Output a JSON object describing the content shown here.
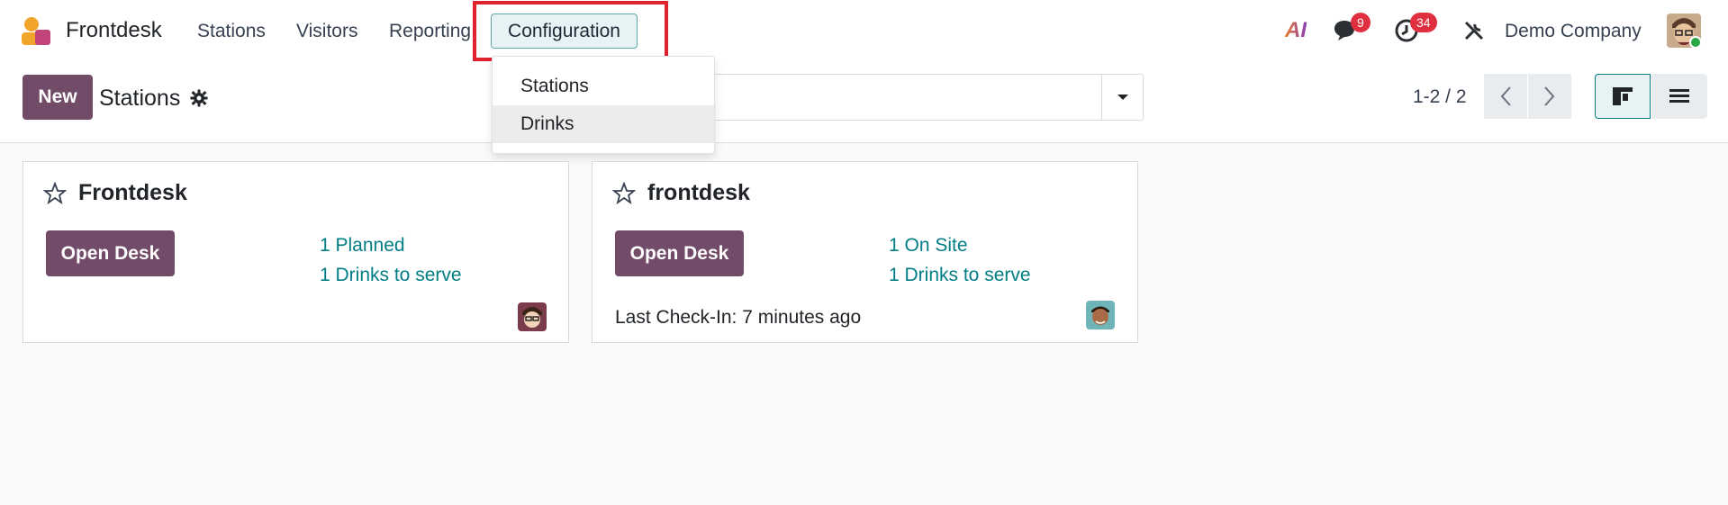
{
  "navbar": {
    "app_name": "Frontdesk",
    "menu": {
      "stations": "Stations",
      "visitors": "Visitors",
      "reporting": "Reporting",
      "configuration": "Configuration"
    },
    "ai_label": "AI",
    "messages_badge": "9",
    "activities_badge": "34",
    "company": "Demo Company"
  },
  "dropdown": {
    "items": [
      "Stations",
      "Drinks"
    ],
    "active_index": 1
  },
  "control_panel": {
    "new_label": "New",
    "title": "Stations",
    "pager": "1-2 / 2"
  },
  "cards": [
    {
      "title": "Frontdesk",
      "button": "Open Desk",
      "stat1": "1 Planned",
      "stat2": "1 Drinks to serve",
      "last_checkin": ""
    },
    {
      "title": "frontdesk",
      "button": "Open Desk",
      "stat1": "1 On Site",
      "stat2": "1 Drinks to serve",
      "last_checkin": "Last Check-In: 7 minutes ago"
    }
  ],
  "colors": {
    "primary": "#714b67",
    "link": "#017e84",
    "badge": "#e0303f",
    "highlight": "#e0212e"
  }
}
